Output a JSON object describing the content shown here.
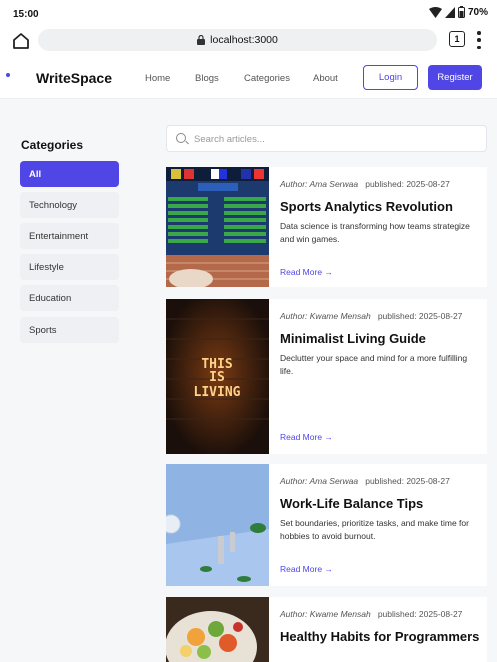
{
  "status": {
    "time": "15:00",
    "battery": "70%"
  },
  "browser": {
    "url": "localhost:3000",
    "tab_count": "1"
  },
  "nav": {
    "brand": "WriteSpace",
    "links": [
      "Home",
      "Blogs",
      "Categories",
      "About"
    ],
    "login": "Login",
    "register": "Register"
  },
  "sidebar": {
    "title": "Categories",
    "items": [
      "All",
      "Technology",
      "Entertainment",
      "Lifestyle",
      "Education",
      "Sports"
    ]
  },
  "search": {
    "placeholder": "Search articles..."
  },
  "posts": [
    {
      "author": "Author: Ama Serwaa",
      "published": "published: 2025-08-27",
      "title": "Sports Analytics Revolution",
      "desc": "Data science is transforming how teams strategize and win games.",
      "read_more": "Read More →",
      "image": "stats-board-image"
    },
    {
      "author": "Author: Kwame Mensah",
      "published": "published: 2025-08-27",
      "title": "Minimalist Living Guide",
      "desc": "Declutter your space and mind for a more fulfilling life.",
      "read_more": "Read More →",
      "image": "neon-sign-image",
      "sign": "THIS IS LIVING"
    },
    {
      "author": "Author: Ama Serwaa",
      "published": "published: 2025-08-27",
      "title": "Work-Life Balance Tips",
      "desc": "Set boundaries, prioritize tasks, and make time for hobbies to avoid burnout.",
      "read_more": "Read More →",
      "image": "desk-image"
    },
    {
      "author": "Author: Kwame Mensah",
      "published": "published: 2025-08-27",
      "title": "Healthy Habits for Programmers",
      "desc": "",
      "read_more": "",
      "image": "salad-image"
    }
  ],
  "colors": {
    "accent": "#4f46e5"
  }
}
